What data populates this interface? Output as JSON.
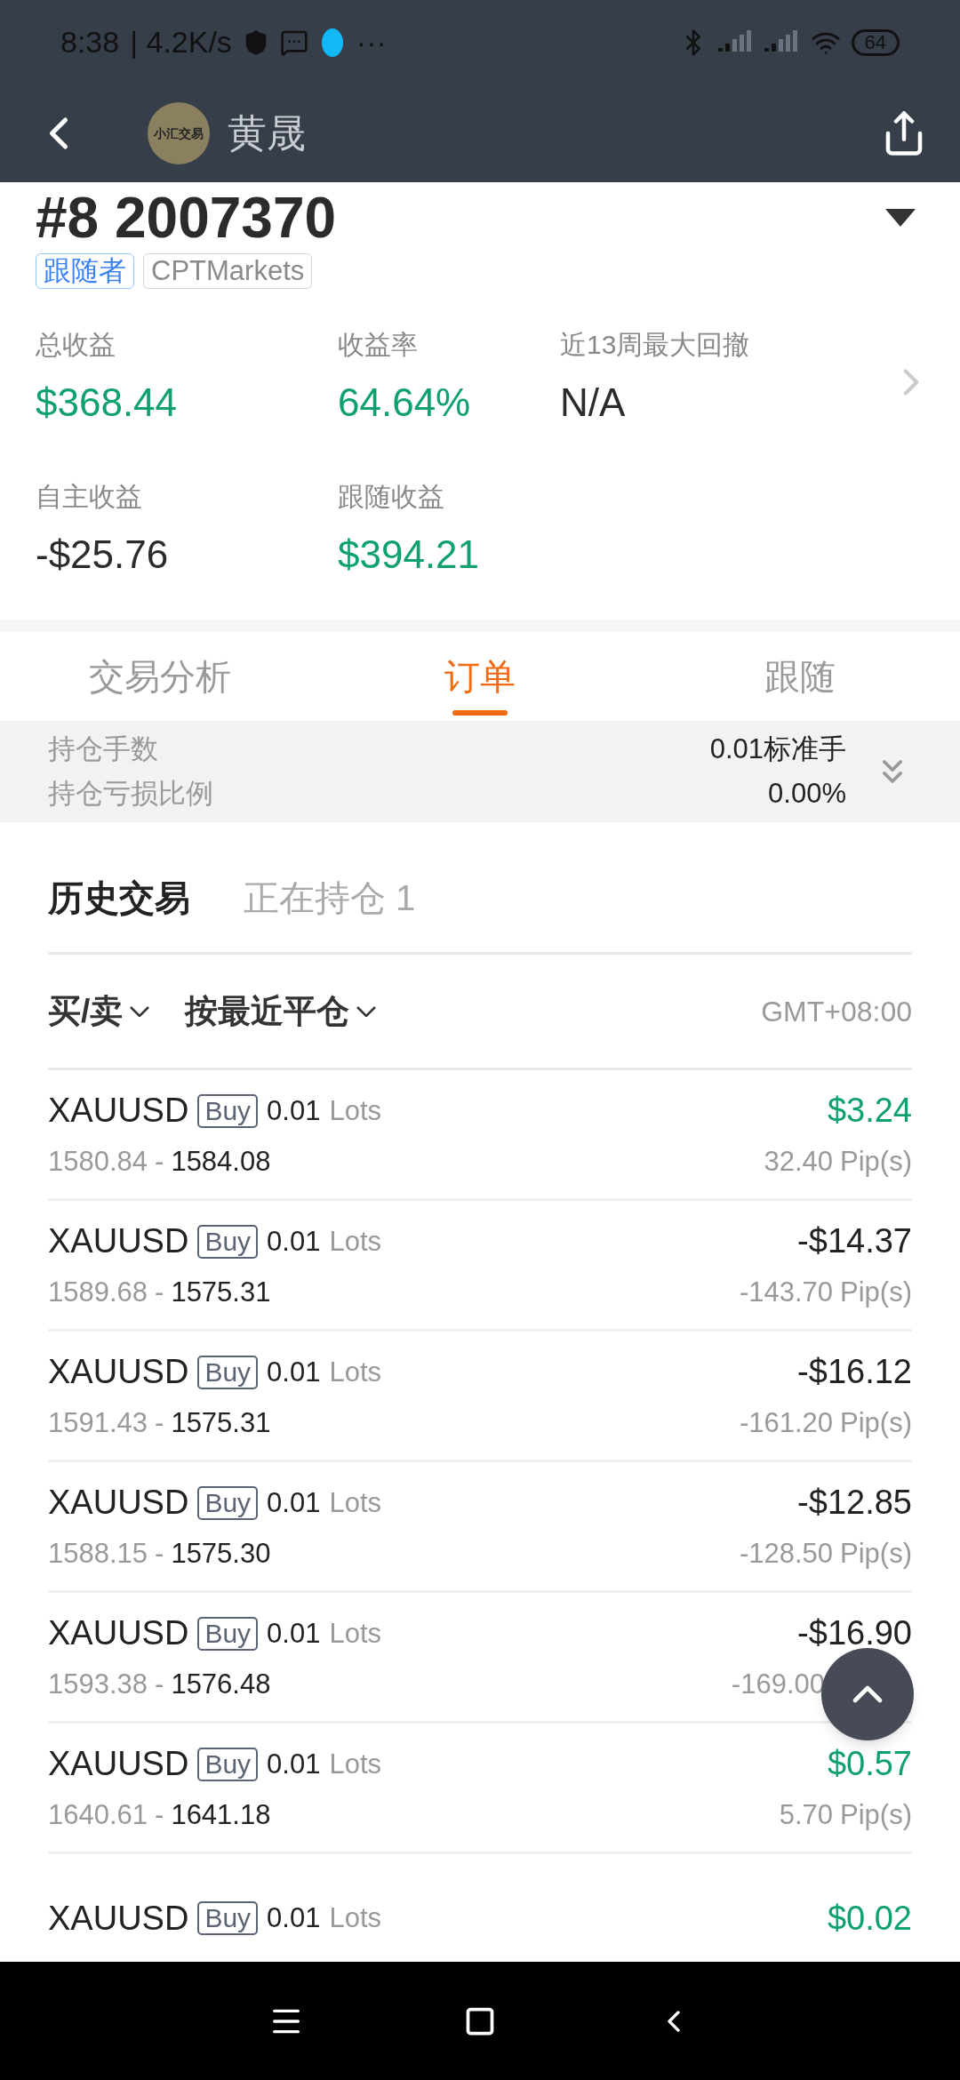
{
  "status_bar": {
    "time": "8:38",
    "speed": "| 4.2K/s",
    "more": "···",
    "battery": "64"
  },
  "header": {
    "avatar_text": "小汇交易",
    "name": "黄晟"
  },
  "account": {
    "title": "#8 2007370",
    "tags": [
      {
        "label": "跟随者",
        "kind": "role"
      },
      {
        "label": "CPTMarkets",
        "kind": "broker"
      }
    ]
  },
  "stats": [
    {
      "label": "总收益",
      "value": "$368.44",
      "positive": true
    },
    {
      "label": "收益率",
      "value": "64.64%",
      "positive": true
    },
    {
      "label": "近13周最大回撤",
      "value": "N/A",
      "positive": false
    },
    {
      "label": "自主收益",
      "value": "-$25.76",
      "positive": false
    },
    {
      "label": "跟随收益",
      "value": "$394.21",
      "positive": true
    }
  ],
  "tabs": [
    {
      "label": "交易分析",
      "selected": false
    },
    {
      "label": "订单",
      "selected": true
    },
    {
      "label": "跟随",
      "selected": false
    }
  ],
  "summary": [
    {
      "label": "持仓手数",
      "value": "0.01标准手"
    },
    {
      "label": "持仓亏损比例",
      "value": "0.00%"
    }
  ],
  "subtabs": [
    {
      "label": "历史交易",
      "selected": true
    },
    {
      "label": "正在持仓 1",
      "selected": false
    }
  ],
  "filters": [
    {
      "label": "买/卖"
    },
    {
      "label": "按最近平仓"
    }
  ],
  "timezone": "GMT+08:00",
  "orders": [
    {
      "symbol": "XAUUSD",
      "side": "Buy",
      "lots": "0.01",
      "lots_unit": "Lots",
      "open": "1580.84",
      "separator": "-",
      "close": "1584.08",
      "profit": "$3.24",
      "positive": true,
      "pips": "32.40",
      "pips_unit": "Pip(s)"
    },
    {
      "symbol": "XAUUSD",
      "side": "Buy",
      "lots": "0.01",
      "lots_unit": "Lots",
      "open": "1589.68",
      "separator": "-",
      "close": "1575.31",
      "profit": "-$14.37",
      "positive": false,
      "pips": "-143.70",
      "pips_unit": "Pip(s)"
    },
    {
      "symbol": "XAUUSD",
      "side": "Buy",
      "lots": "0.01",
      "lots_unit": "Lots",
      "open": "1591.43",
      "separator": "-",
      "close": "1575.31",
      "profit": "-$16.12",
      "positive": false,
      "pips": "-161.20",
      "pips_unit": "Pip(s)"
    },
    {
      "symbol": "XAUUSD",
      "side": "Buy",
      "lots": "0.01",
      "lots_unit": "Lots",
      "open": "1588.15",
      "separator": "-",
      "close": "1575.30",
      "profit": "-$12.85",
      "positive": false,
      "pips": "-128.50",
      "pips_unit": "Pip(s)"
    },
    {
      "symbol": "XAUUSD",
      "side": "Buy",
      "lots": "0.01",
      "lots_unit": "Lots",
      "open": "1593.38",
      "separator": "-",
      "close": "1576.48",
      "profit": "-$16.90",
      "positive": false,
      "pips": "-169.00"
    },
    {
      "symbol": "XAUUSD",
      "side": "Buy",
      "lots": "0.01",
      "lots_unit": "Lots",
      "open": "1640.61",
      "separator": "-",
      "close": "1641.18",
      "profit": "$0.57",
      "positive": true,
      "pips": "5.70",
      "pips_unit": "Pip(s)"
    },
    {
      "symbol": "XAUUSD",
      "side": "Buy",
      "lots": "0.01",
      "lots_unit": "Lots",
      "profit": "$0.02",
      "positive": true
    }
  ]
}
